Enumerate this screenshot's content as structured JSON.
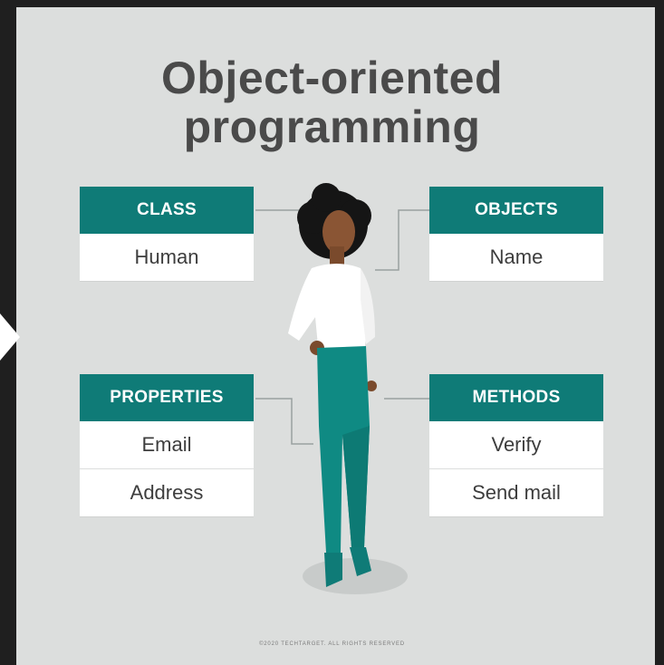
{
  "title": {
    "line1": "Object-oriented",
    "line2": "programming"
  },
  "cards": {
    "class": {
      "header": "CLASS",
      "rows": [
        "Human"
      ]
    },
    "objects": {
      "header": "OBJECTS",
      "rows": [
        "Name"
      ]
    },
    "properties": {
      "header": "PROPERTIES",
      "rows": [
        "Email",
        "Address"
      ]
    },
    "methods": {
      "header": "METHODS",
      "rows": [
        "Verify",
        "Send mail"
      ]
    }
  },
  "footer": "©2020 TECHTARGET. ALL RIGHTS RESERVED",
  "colors": {
    "accent": "#0f7b77",
    "background": "#dcdedd",
    "title": "#4a4a4a",
    "frame": "#1f1f1f"
  }
}
